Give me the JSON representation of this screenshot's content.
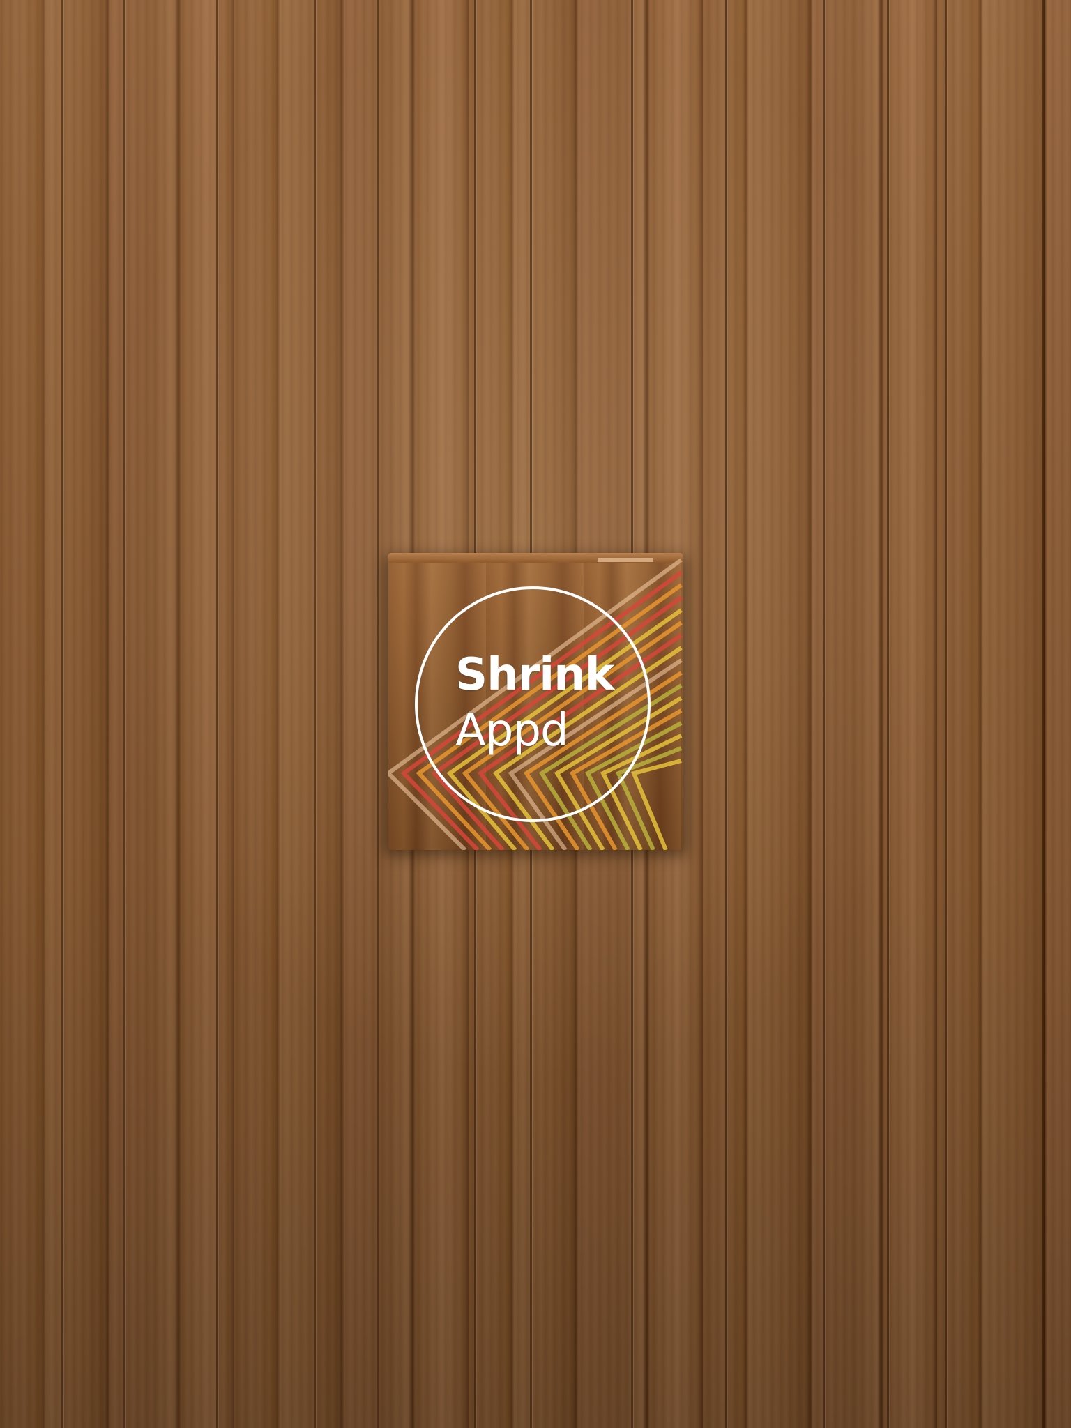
{
  "app_icon": {
    "title": "Shrink",
    "subtitle": "Appd",
    "icon_name": "shrink-appd-app-icon"
  },
  "colors": {
    "wood_base": "#8b5a30",
    "ring": "#ffffff",
    "stripe_red": "#d8463a",
    "stripe_orange": "#e8962e",
    "stripe_yellow": "#e6c23a",
    "stripe_green": "#b9b13a",
    "stripe_cream": "#f0c8a0"
  }
}
